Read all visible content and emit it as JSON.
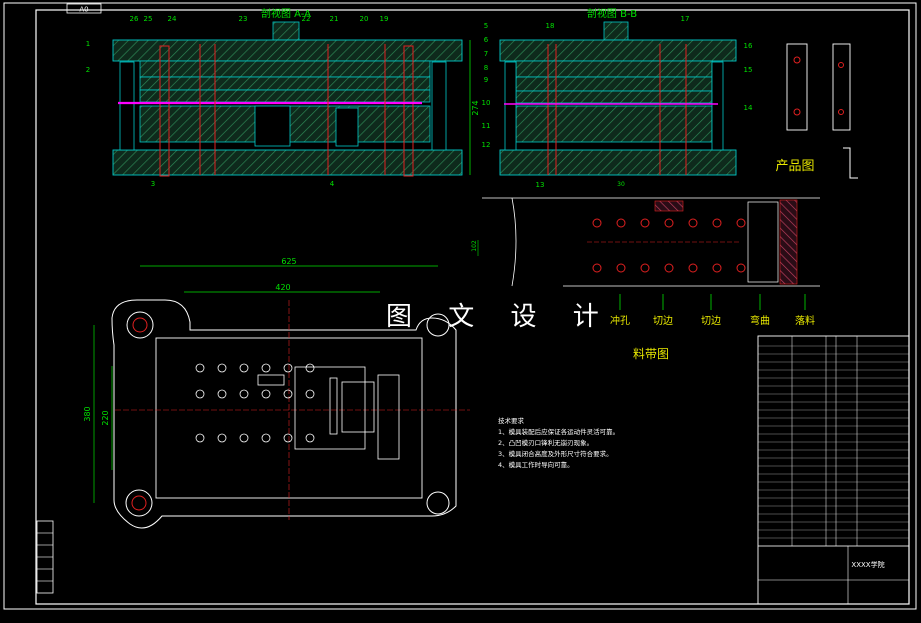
{
  "sheet": {
    "corner_tag": "A0",
    "watermark": "图 文 设 计",
    "colors": {
      "background": "#000000",
      "frame": "#ffffff",
      "hatch": "#2e8b57",
      "cyan": "#00c8c8",
      "red": "#e02020",
      "yellow": "#e8e800",
      "green": "#00e000",
      "magenta": "#ff00ff"
    }
  },
  "views": {
    "section_a_title": "剖视图 A-A",
    "section_b_title": "剖视图 B-B",
    "product_title": "产品图",
    "strip_title": "料带图"
  },
  "section_a_callouts": [
    "1",
    "2",
    "3",
    "4",
    "19",
    "20",
    "21",
    "22",
    "23",
    "24",
    "25",
    "26"
  ],
  "section_b_callouts": [
    "5",
    "6",
    "7",
    "8",
    "9",
    "10",
    "11",
    "12",
    "13",
    "14",
    "15",
    "16",
    "17",
    "18"
  ],
  "dimensions": {
    "section_height": "274",
    "plan_width": "625",
    "plan_inner_width": "420",
    "plan_height": "380",
    "plan_inner_height": "220",
    "strip_pitch": "30",
    "strip_width": "102"
  },
  "strip_stations": [
    "冲孔",
    "切边",
    "切边",
    "弯曲",
    "落料"
  ],
  "notes": {
    "heading": "技术要求",
    "items": [
      "1、模具装配后应保证各运动件灵活可靠。",
      "2、凸凹模刃口锋利无崩刃现象。",
      "3、模具闭合高度及外形尺寸符合要求。",
      "4、模具工作时导向可靠。"
    ]
  },
  "title_block": {
    "school": "XXXX学院"
  }
}
